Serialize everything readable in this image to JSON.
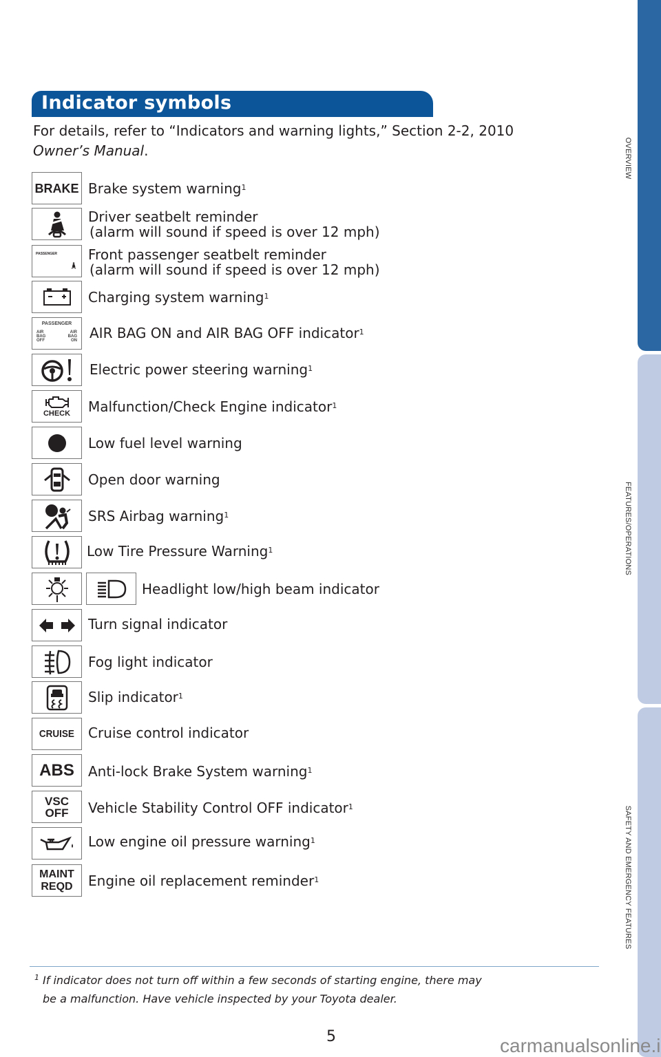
{
  "side_tabs": [
    {
      "label": "OVERVIEW",
      "active": true,
      "color": "#2a67a3"
    },
    {
      "label": "FEATURES/OPERATIONS",
      "active": false,
      "color": "#bfcbe3"
    },
    {
      "label": "SAFETY AND EMERGENCY FEATURES",
      "active": false,
      "color": "#bfcbe3"
    }
  ],
  "header": {
    "title": "Indicator symbols",
    "title_bg": "#0c5599",
    "intro_line1": "For details, refer to “Indicators and warning lights,” Section 2-2, 2010",
    "intro_line2_italic": "Owner’s Manual",
    "intro_line2_suffix": "."
  },
  "indicators": [
    {
      "icon": "brake-text-icon",
      "icon_text": "BRAKE",
      "label": "Brake system warning",
      "note": "1"
    },
    {
      "icon": "driver-seatbelt-icon",
      "label": "Driver seatbelt reminder",
      "sublabel": "(alarm will sound if speed is over 12 mph)",
      "note": ""
    },
    {
      "icon": "passenger-seatbelt-icon",
      "icon_text": "PASSENGER",
      "label": "Front passenger seatbelt reminder",
      "sublabel": "(alarm will sound if speed is over 12 mph)",
      "note": ""
    },
    {
      "icon": "battery-icon",
      "label": "Charging system warning",
      "note": "1"
    },
    {
      "icon": "airbag-on-off-icon",
      "icon_text_top": "PASSENGER",
      "icon_text_left": "AIR BAG OFF",
      "icon_text_right": "AIR BAG ON",
      "label": "AIR BAG ON and AIR BAG OFF indicator",
      "note": "1"
    },
    {
      "icon": "power-steering-icon",
      "label": "Electric power steering warning",
      "note": "1"
    },
    {
      "icon": "check-engine-icon",
      "icon_text": "CHECK",
      "label": "Malfunction/Check Engine indicator",
      "note": "1"
    },
    {
      "icon": "low-fuel-dot-icon",
      "label": "Low fuel level warning",
      "note": ""
    },
    {
      "icon": "open-door-icon",
      "label": "Open door warning",
      "note": ""
    },
    {
      "icon": "srs-airbag-icon",
      "label": "SRS Airbag warning",
      "note": "1"
    },
    {
      "icon": "tire-pressure-icon",
      "label": "Low Tire Pressure Warning",
      "note": "1"
    },
    {
      "icon": "headlight-icon",
      "icon2": "high-beam-icon",
      "label": "Headlight low/high beam indicator",
      "note": ""
    },
    {
      "icon": "turn-signal-icon",
      "label": "Turn signal indicator",
      "note": ""
    },
    {
      "icon": "fog-light-icon",
      "label": "Fog light indicator",
      "note": ""
    },
    {
      "icon": "slip-icon",
      "label": "Slip indicator",
      "note": "1"
    },
    {
      "icon": "cruise-text-icon",
      "icon_text": "CRUISE",
      "label": "Cruise control indicator",
      "note": ""
    },
    {
      "icon": "abs-text-icon",
      "icon_text": "ABS",
      "label": "Anti-lock Brake System warning",
      "note": "1"
    },
    {
      "icon": "vsc-off-text-icon",
      "icon_text_1": "VSC",
      "icon_text_2": "OFF",
      "label": "Vehicle Stability Control OFF indicator",
      "note": "1"
    },
    {
      "icon": "oil-pressure-icon",
      "label": "Low engine oil pressure warning",
      "note": "1"
    },
    {
      "icon": "maint-reqd-text-icon",
      "icon_text_1": "MAINT",
      "icon_text_2": "REQD",
      "label": "Engine oil replacement reminder",
      "note": "1"
    }
  ],
  "footnote": {
    "marker": "1",
    "line1": "If indicator does not turn off within a few seconds of starting engine, there may",
    "line2": "be a malfunction. Have vehicle inspected by your Toyota dealer."
  },
  "page_number": "5",
  "watermark": "carmanualsonline.info"
}
